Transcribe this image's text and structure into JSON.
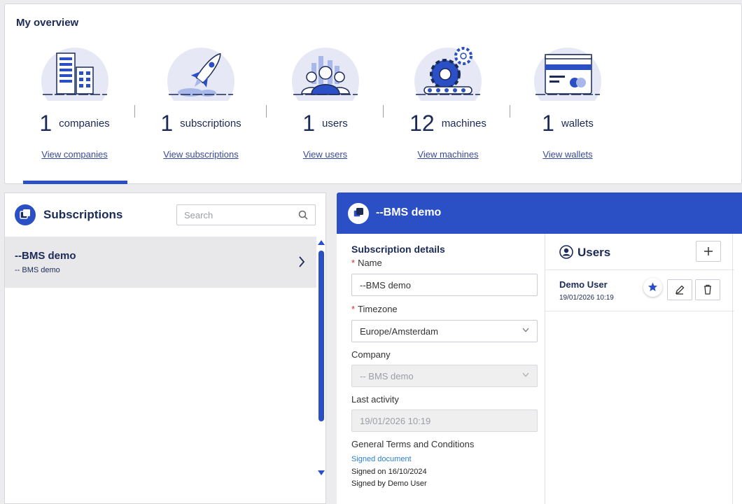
{
  "overview": {
    "title": "My overview",
    "stats": [
      {
        "number": "1",
        "label": "companies",
        "link": "View companies",
        "icon": "buildings-icon"
      },
      {
        "number": "1",
        "label": "subscriptions",
        "link": "View subscriptions",
        "icon": "rocket-icon"
      },
      {
        "number": "1",
        "label": "users",
        "link": "View users",
        "icon": "people-icon"
      },
      {
        "number": "12",
        "label": "machines",
        "link": "View machines",
        "icon": "gears-icon"
      },
      {
        "number": "1",
        "label": "wallets",
        "link": "View wallets",
        "icon": "wallet-icon"
      }
    ]
  },
  "subscriptions": {
    "title": "Subscriptions",
    "search_placeholder": "Search",
    "items": [
      {
        "name": "--BMS demo",
        "subtitle": "-- BMS demo"
      }
    ]
  },
  "detail": {
    "title": "--BMS demo",
    "section_title": "Subscription details",
    "name_label": "Name",
    "name_value": "--BMS  demo",
    "timezone_label": "Timezone",
    "timezone_value": "Europe/Amsterdam",
    "company_label": "Company",
    "company_value": "-- BMS demo",
    "last_activity_label": "Last activity",
    "last_activity_value": "19/01/2026 10:19",
    "gtc_label": "General Terms and Conditions",
    "gtc_link": "Signed document",
    "gtc_signed_on": "Signed on 16/10/2024",
    "gtc_signed_by": "Signed by Demo User",
    "required_marker": "*"
  },
  "users": {
    "title": "Users",
    "add_label": "+",
    "list": [
      {
        "name": "Demo User",
        "date": "19/01/2026 10:19"
      }
    ]
  },
  "colors": {
    "accent": "#2b4fc4",
    "navy": "#1b2a57",
    "required": "#d0312d"
  }
}
